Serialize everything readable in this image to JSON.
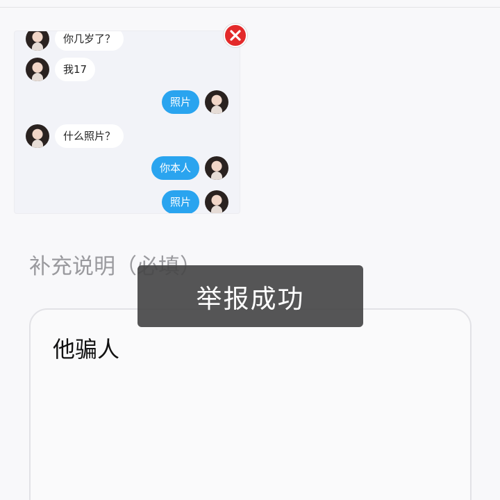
{
  "thumbnail": {
    "messages": [
      {
        "side": "left",
        "text": "你几岁了？"
      },
      {
        "side": "left",
        "text": "我17"
      },
      {
        "side": "right",
        "text": "照片"
      },
      {
        "side": "left",
        "text": "什么照片？"
      },
      {
        "side": "right",
        "text": "你本人"
      },
      {
        "side": "right",
        "text": "照片"
      }
    ],
    "remove_icon": "close-icon"
  },
  "form": {
    "supplement_label": "补充说明（必填）",
    "description_value": "他骗人"
  },
  "toast": {
    "message": "举报成功"
  },
  "colors": {
    "outgoing_bubble": "#2aa4ef",
    "incoming_bubble": "#ffffff",
    "remove_button": "#e32a2a",
    "toast_bg": "#464648"
  }
}
